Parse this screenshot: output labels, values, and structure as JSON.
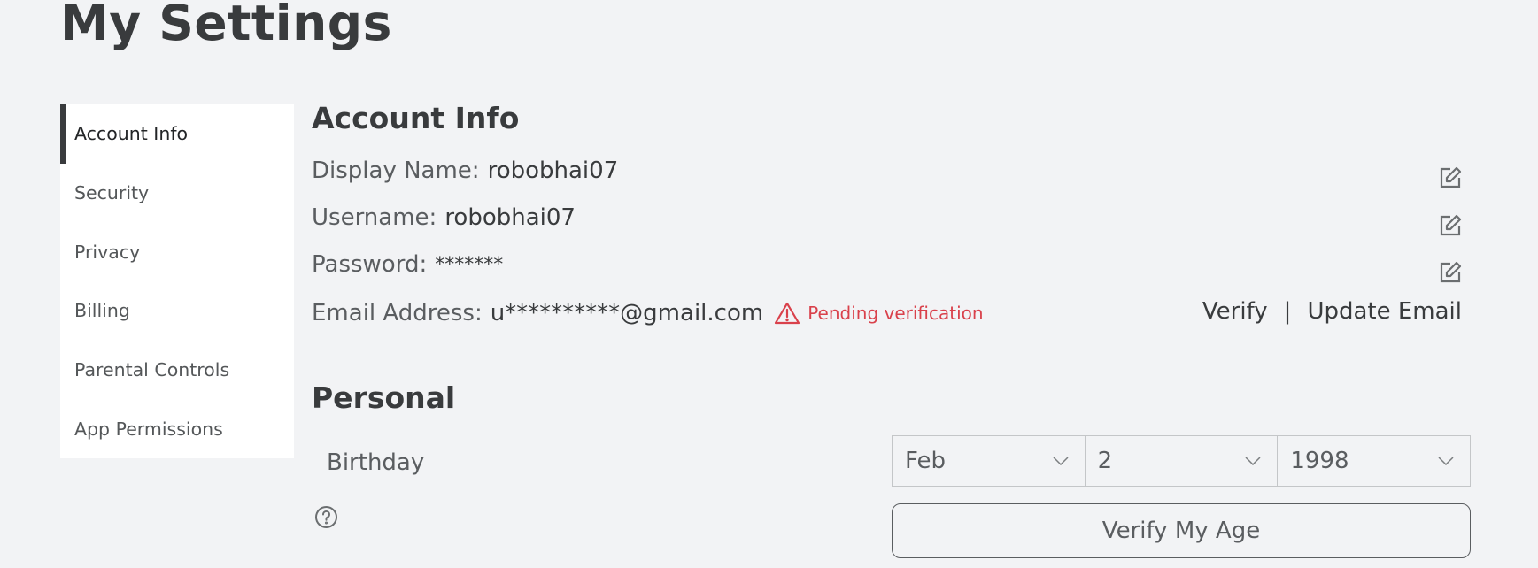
{
  "page": {
    "title": "My Settings"
  },
  "sidebar": {
    "active_index": 0,
    "items": [
      {
        "label": "Account Info"
      },
      {
        "label": "Security"
      },
      {
        "label": "Privacy"
      },
      {
        "label": "Billing"
      },
      {
        "label": "Parental Controls"
      },
      {
        "label": "App Permissions"
      }
    ]
  },
  "account_info": {
    "heading": "Account Info",
    "display_name": {
      "label": "Display Name:",
      "value": "robobhai07",
      "icon": "edit-icon"
    },
    "username": {
      "label": "Username:",
      "value": "robobhai07",
      "icon": "edit-icon"
    },
    "password": {
      "label": "Password:",
      "value": "*******",
      "icon": "edit-icon"
    },
    "email": {
      "label": "Email Address:",
      "value": "u**********@gmail.com",
      "status_icon": "warning-triangle-icon",
      "status": "Pending verification",
      "verify_label": "Verify",
      "separator": "|",
      "update_label": "Update Email"
    }
  },
  "personal": {
    "heading": "Personal",
    "birthday": {
      "label": "Birthday",
      "help_icon": "question-circle-icon",
      "month": "Feb",
      "day": "2",
      "year": "1998"
    },
    "verify_age_label": "Verify My Age"
  },
  "colors": {
    "background": "#f2f3f5",
    "text_primary": "#393b3d",
    "text_secondary": "#5a5d60",
    "warning": "#d9414b",
    "sidebar_bg": "#ffffff"
  }
}
